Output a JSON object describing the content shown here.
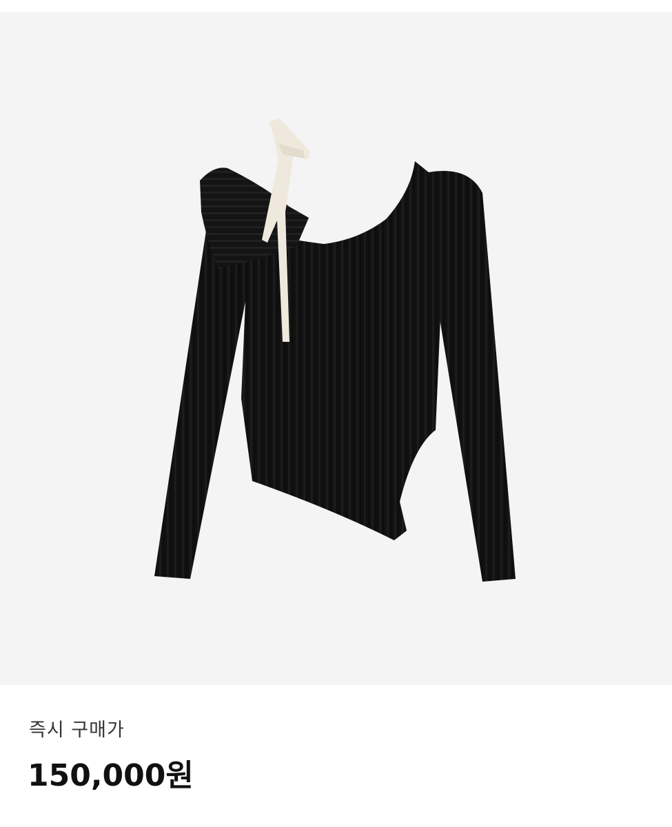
{
  "product": {
    "image_subject": "black-ribbed-knit-top-icon",
    "image_background": "#f4f4f4",
    "garment_color": "#111111",
    "ribbon_color": "#efe9dd"
  },
  "pricing": {
    "label": "즉시 구매가",
    "value": "150,000원"
  }
}
